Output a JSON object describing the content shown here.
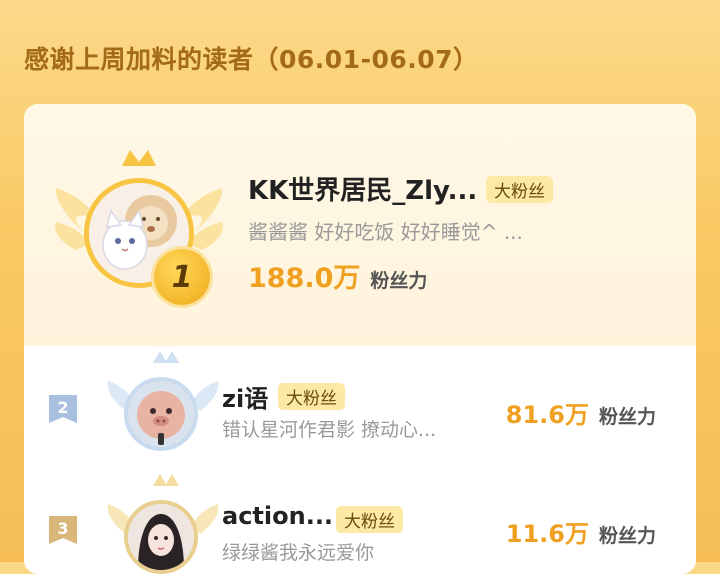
{
  "section": {
    "title": "感谢上周加料的读者（06.01-06.07）"
  },
  "fan_tag": "大粉丝",
  "power_label": "粉丝力",
  "colors": {
    "accent_orange": "#f0a020",
    "gold": "#f7c542",
    "tag_bg": "#fce9a5"
  },
  "readers": [
    {
      "rank": "1",
      "name": "KK世界居民_Zly...",
      "tag": "大粉丝",
      "motto": "酱酱酱 好好吃饭 好好睡觉^ ...",
      "power": "188.0万",
      "power_label": "粉丝力",
      "avatar_icon": "cat-and-lion-avatar"
    },
    {
      "rank": "2",
      "name": "zi语",
      "tag": "大粉丝",
      "motto": "错认星河作君影 撩动心...",
      "power": "81.6万",
      "power_label": "粉丝力",
      "avatar_icon": "pig-avatar"
    },
    {
      "rank": "3",
      "name": "action...",
      "tag": "大粉丝",
      "motto": "绿绿酱我永远爱你",
      "power": "11.6万",
      "power_label": "粉丝力",
      "avatar_icon": "anime-girl-avatar"
    }
  ]
}
